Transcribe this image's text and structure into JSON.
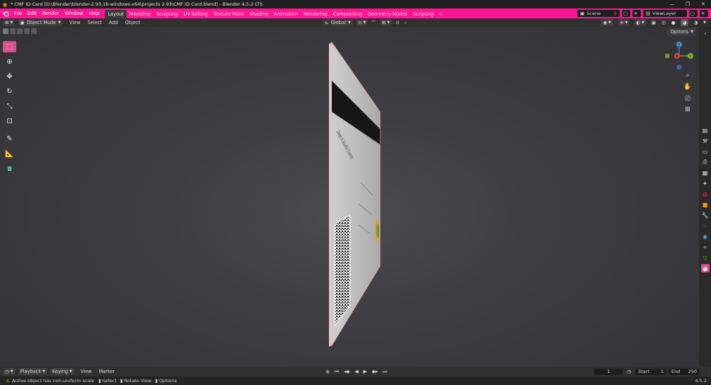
{
  "titlebar": {
    "title": "* CMF ID Card [D:\\Blender\\blender-2.93.18-windows-x64\\projects 2.93\\CMF ID Card.blend] - Blender 4.5.2 LTS",
    "minimize": "—",
    "maximize": "❐",
    "close": "✕"
  },
  "menu": [
    "File",
    "Edit",
    "Render",
    "Window",
    "Help"
  ],
  "workspaces": [
    "Layout",
    "Modeling",
    "Sculpting",
    "UV Editing",
    "Texture Paint",
    "Shading",
    "Animation",
    "Rendering",
    "Compositing",
    "Geometry Nodes",
    "Scripting"
  ],
  "workspace_add": "+",
  "scene": {
    "label": "Scene",
    "view_layer": "ViewLayer"
  },
  "viewport_header": {
    "mode": "Object Mode",
    "menus": [
      "View",
      "Select",
      "Add",
      "Object"
    ],
    "orientation": "Global",
    "options": "Options"
  },
  "gizmo": {
    "z": "Z",
    "y": "Y",
    "x": "X"
  },
  "card": {
    "name_text": "Deep N Soulful Events"
  },
  "timeline": {
    "menus": [
      "Playback",
      "Keying",
      "View",
      "Marker"
    ],
    "current_frame": "1",
    "start_label": "Start",
    "start": "1",
    "end_label": "End",
    "end": "250"
  },
  "status": {
    "message": "Active object has non-uniform scale",
    "select": "Select",
    "rotate": "Rotate View",
    "options": "Options",
    "version": "4.5.2"
  },
  "colors": {
    "accent": "#ff1493",
    "active_tool": "#d94f8f"
  }
}
